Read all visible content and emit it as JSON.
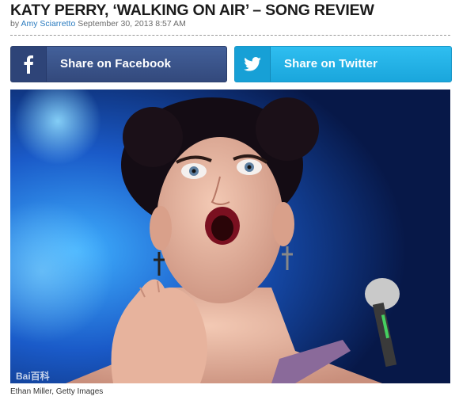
{
  "article": {
    "title": "KATY PERRY, ‘WALKING ON AIR’ – SONG REVIEW",
    "by_prefix": "by",
    "author": "Amy Sciarretto",
    "date": "September 30, 2013 8:57 AM"
  },
  "share": {
    "facebook": {
      "label": "Share on Facebook",
      "icon": "facebook-icon",
      "color": "#3b5998"
    },
    "twitter": {
      "label": "Share on Twitter",
      "icon": "twitter-icon",
      "color": "#1da1e2"
    }
  },
  "photo": {
    "watermark": "Bai百科",
    "caption": "Ethan Miller, Getty Images"
  }
}
